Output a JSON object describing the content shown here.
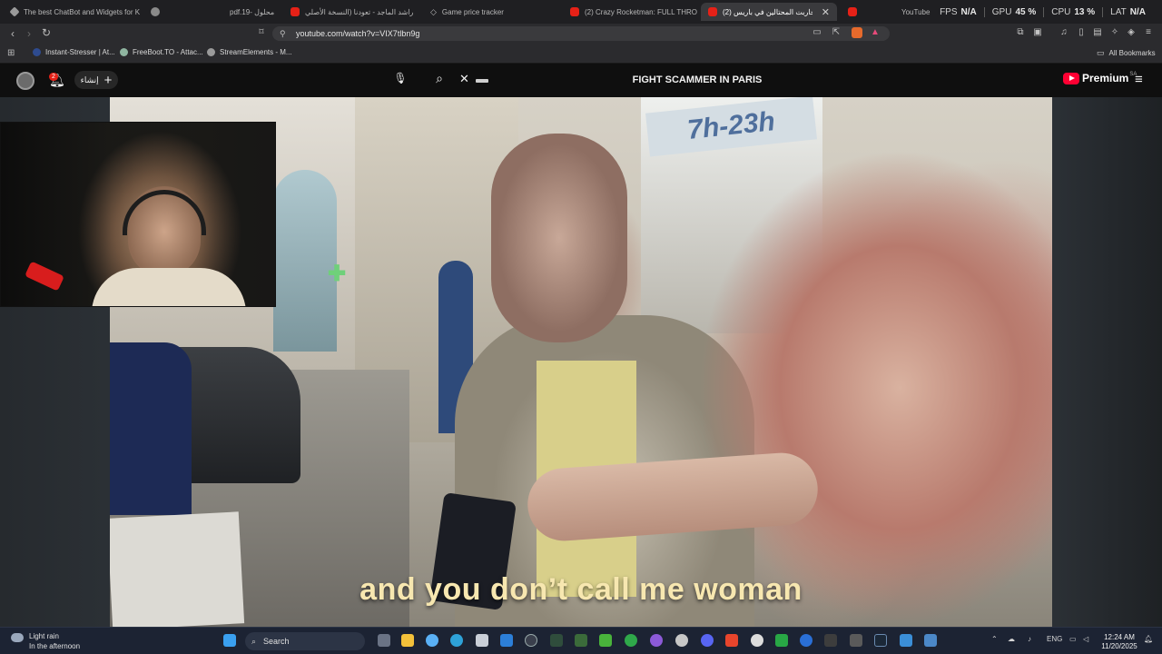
{
  "browser": {
    "tabs": [
      {
        "title": "The best ChatBot and Widgets for K",
        "icon": "chatbot-icon",
        "active": false
      },
      {
        "title": "",
        "icon": "globe-icon",
        "active": false
      },
      {
        "title": "pdf.محلول -19",
        "icon": "",
        "active": false
      },
      {
        "title": "راشد الماجد - تعودنا (النسخة الأصلي",
        "icon": "youtube-icon",
        "active": false
      },
      {
        "title": "Game price tracker",
        "icon": "tag-icon",
        "active": false
      },
      {
        "title": "(2) Crazy Rocketman: FULL THROTTI",
        "icon": "youtube-icon",
        "active": false
      },
      {
        "title": "(2) حاربت المحتالين في باريس! *..",
        "icon": "youtube-icon",
        "active": true
      },
      {
        "title": "",
        "icon": "youtube-icon",
        "active": false
      },
      {
        "title": "YouTube - كاني لبناني",
        "icon": "",
        "active": false
      }
    ],
    "url": "youtube.com/watch?v=VIX7tlbn9g",
    "bookmarks": [
      "Instant-Stresser | At...",
      "FreeBoot.TO - Attac...",
      "StreamElements - M..."
    ],
    "all_bookmarks_label": "All Bookmarks"
  },
  "overlay_stats": [
    {
      "label": "FPS",
      "value": "N/A"
    },
    {
      "label": "GPU",
      "value": "45 %"
    },
    {
      "label": "CPU",
      "value": "13 %"
    },
    {
      "label": "LAT",
      "value": "N/A"
    }
  ],
  "youtube": {
    "create_label": "إنشاء",
    "notification_count": "2",
    "video_title": "FIGHT SCAMMER IN PARIS",
    "premium_label": "Premium",
    "region": "SA"
  },
  "video": {
    "subtitle": "and you don’t call me woman",
    "store_sign": "7h-23h"
  },
  "taskbar": {
    "weather_title": "Light rain",
    "weather_sub": "In the afternoon",
    "search_placeholder": "Search",
    "language": "ENG",
    "time": "12:24 AM",
    "date": "11/20/2025"
  },
  "colors": {
    "youtube_red": "#ff0033",
    "subtitle": "#f7e7b0",
    "taskbar": "#1c2333"
  }
}
